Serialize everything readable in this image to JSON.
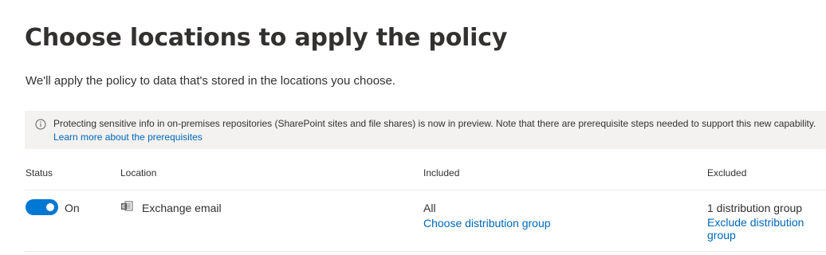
{
  "page": {
    "title": "Choose locations to apply the policy",
    "description": "We'll apply the policy to data that's stored in the locations you choose."
  },
  "info_bar": {
    "icon": "info-icon",
    "message": "Protecting sensitive info in on-premises repositories (SharePoint sites and file shares) is now in preview. Note that there are prerequisite steps needed to support this new capability.",
    "link_label": "Learn more about the prerequisites"
  },
  "table": {
    "headers": {
      "status": "Status",
      "location": "Location",
      "included": "Included",
      "excluded": "Excluded"
    },
    "rows": [
      {
        "status_on": true,
        "status_label": "On",
        "location_icon": "exchange-icon",
        "location": "Exchange email",
        "included_value": "All",
        "included_link": "Choose distribution group",
        "excluded_value": "1 distribution group",
        "excluded_link": "Exclude distribution group"
      }
    ]
  },
  "colors": {
    "accent": "#0078d4",
    "link": "#0067b8",
    "info_bar_background": "#f3f2f1",
    "text": "#323130"
  }
}
